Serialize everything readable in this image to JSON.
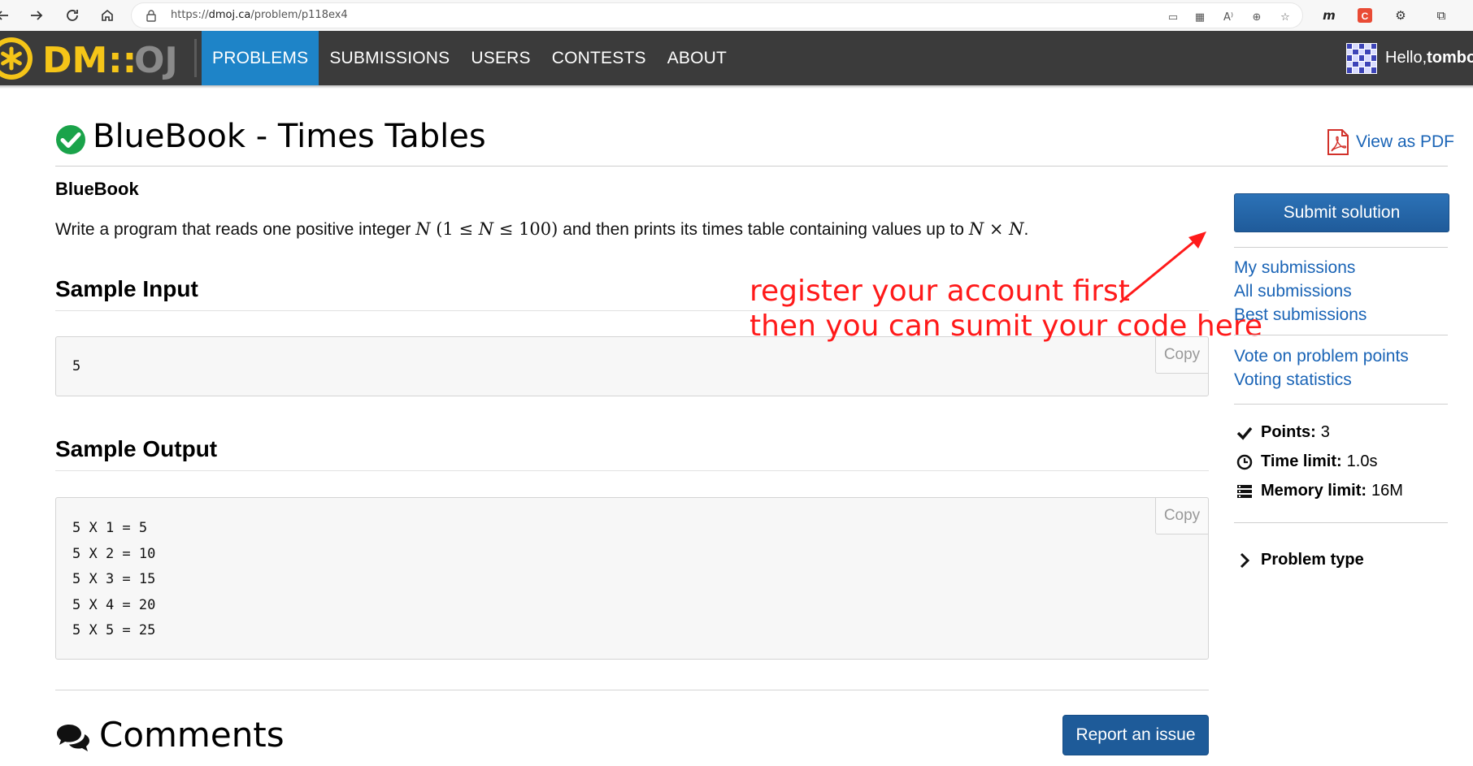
{
  "browser": {
    "url_scheme": "https://",
    "url_host": "dmoj.ca",
    "url_path": "/problem/p118ex4"
  },
  "site": {
    "logo_text": "DM::OJ",
    "nav_items": [
      {
        "label": "PROBLEMS",
        "active": true
      },
      {
        "label": "SUBMISSIONS",
        "active": false
      },
      {
        "label": "USERS",
        "active": false
      },
      {
        "label": "CONTESTS",
        "active": false
      },
      {
        "label": "ABOUT",
        "active": false
      }
    ],
    "greeting": "Hello, ",
    "username": "tombo"
  },
  "problem": {
    "title": "BlueBook - Times Tables",
    "pdf_label": "View as PDF",
    "author": "BlueBook",
    "statement": {
      "before": "Write a program that reads one positive integer ",
      "var_n": "N",
      "range_open": " (1 ≤ ",
      "range_var": "N",
      "range_close": " ≤ 100)",
      "middle": " and then prints its times table containing values up to ",
      "product": "N × N",
      "end": "."
    },
    "sample_input_heading": "Sample Input",
    "sample_input": "5",
    "sample_output_heading": "Sample Output",
    "sample_output": "5 X 1 = 5\n5 X 2 = 10\n5 X 3 = 15\n5 X 4 = 20\n5 X 5 = 25",
    "copy_label": "Copy",
    "comments_title": "Comments",
    "report_label": "Report an issue"
  },
  "annotation": {
    "line1": "register your account first",
    "line2": "then you can sumit your code here",
    "color": "#ff1a1a"
  },
  "sidebar": {
    "submit_label": "Submit solution",
    "links_group1": [
      "My submissions",
      "All submissions",
      "Best submissions"
    ],
    "links_group2": [
      "Vote on problem points",
      "Voting statistics"
    ],
    "points_label": "Points:",
    "points_value": "3",
    "time_label": "Time limit:",
    "time_value": "1.0s",
    "memory_label": "Memory limit:",
    "memory_value": "16M",
    "problem_type_label": "Problem type"
  },
  "colors": {
    "nav_bg": "#3b3b3b",
    "nav_active": "#1e84c8",
    "link": "#1a64b6",
    "button": "#1e5b99",
    "logo_yellow": "#f5c518"
  }
}
